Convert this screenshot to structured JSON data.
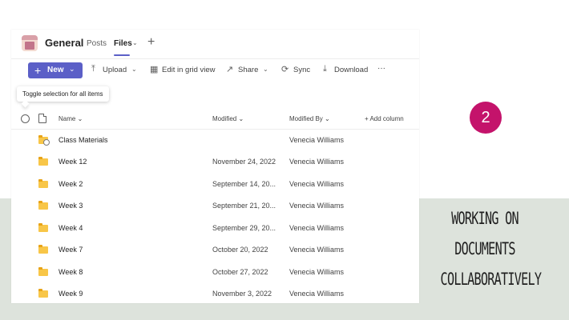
{
  "header": {
    "team_name": "General",
    "tabs": [
      {
        "label": "Posts"
      },
      {
        "label": "Files"
      }
    ],
    "add_tab_icon": "plus-icon"
  },
  "toolbar": {
    "new_label": "New",
    "upload_label": "Upload",
    "grid_label": "Edit in grid view",
    "share_label": "Share",
    "sync_label": "Sync",
    "download_label": "Download",
    "more_label": "···"
  },
  "tooltip": "Toggle selection for all items",
  "columns": {
    "name": "Name",
    "modified": "Modified",
    "modified_by": "Modified By",
    "add_column": "Add column"
  },
  "rows": [
    {
      "name": "Class Materials",
      "modified": "",
      "modified_by": "Venecia Williams"
    },
    {
      "name": "Week 12",
      "modified": "November 24, 2022",
      "modified_by": "Venecia Williams"
    },
    {
      "name": "Week 2",
      "modified": "September 14, 20...",
      "modified_by": "Venecia Williams"
    },
    {
      "name": "Week 3",
      "modified": "September 21, 20...",
      "modified_by": "Venecia Williams"
    },
    {
      "name": "Week 4",
      "modified": "September 29, 20...",
      "modified_by": "Venecia Williams"
    },
    {
      "name": "Week 7",
      "modified": "October 20, 2022",
      "modified_by": "Venecia Williams"
    },
    {
      "name": "Week 8",
      "modified": "October 27, 2022",
      "modified_by": "Venecia Williams"
    },
    {
      "name": "Week 9",
      "modified": "November 3, 2022",
      "modified_by": "Venecia Williams"
    }
  ],
  "slide": {
    "step_number": "2",
    "caption_lines": [
      "WORKING ON",
      "DOCUMENTS",
      "COLLABORATIVELY"
    ]
  },
  "colors": {
    "accent": "#5b5fc7",
    "badge": "#c4136b",
    "folder": "#f8c648",
    "background_green": "#dde3dc"
  }
}
